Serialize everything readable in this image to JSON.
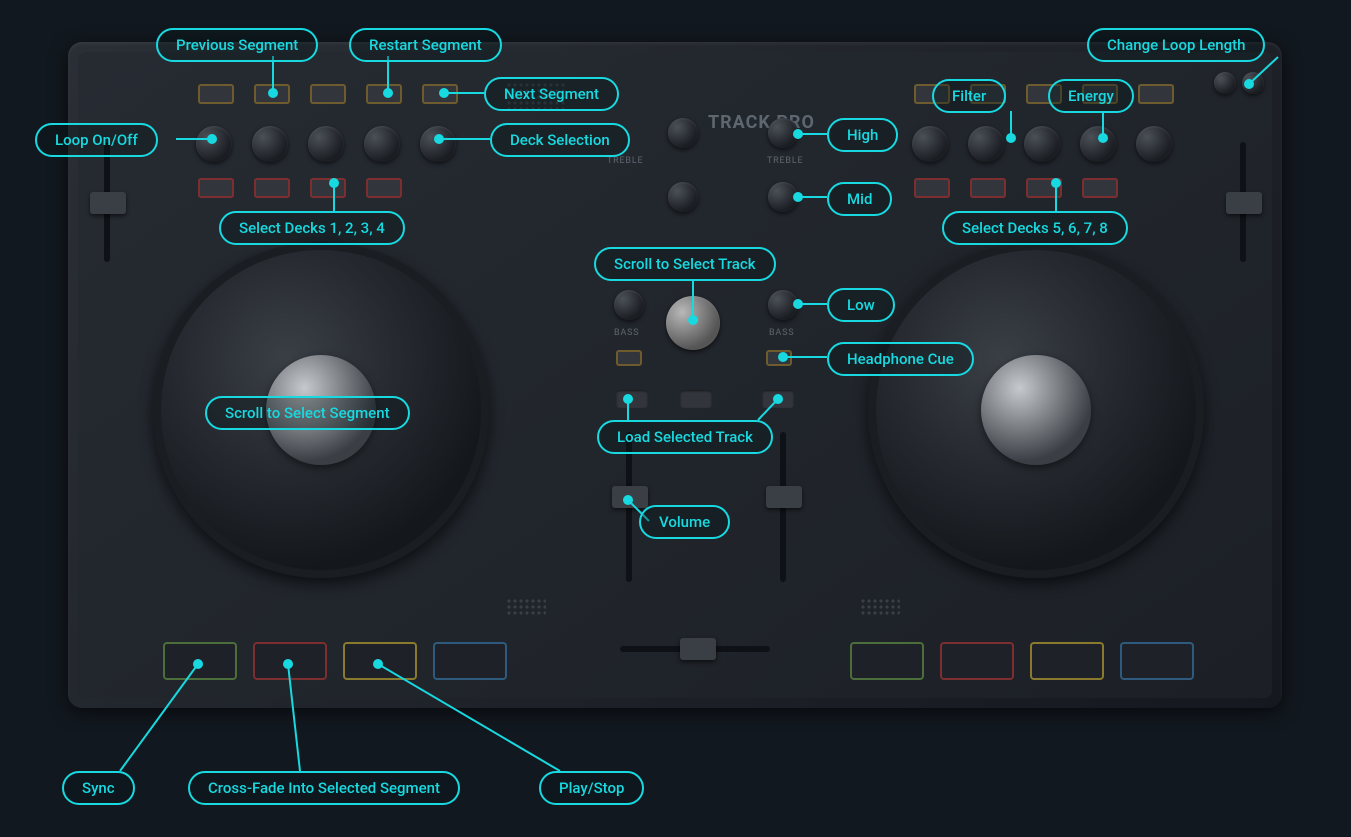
{
  "product": {
    "name": "TRACK PRO"
  },
  "eq": {
    "treble": "TREBLE",
    "bass": "BASS"
  },
  "labels": {
    "previous_segment": "Previous Segment",
    "restart_segment": "Restart Segment",
    "next_segment": "Next Segment",
    "change_loop_length": "Change Loop Length",
    "loop_on_off": "Loop On/Off",
    "deck_selection": "Deck Selection",
    "filter": "Filter",
    "energy": "Energy",
    "high": "High",
    "mid": "Mid",
    "low": "Low",
    "select_decks_left": "Select Decks 1, 2, 3, 4",
    "select_decks_right": "Select Decks 5, 6, 7, 8",
    "scroll_select_track": "Scroll to Select Track",
    "headphone_cue": "Headphone Cue",
    "scroll_select_segment": "Scroll to Select Segment",
    "load_selected_track": "Load Selected Track",
    "volume": "Volume",
    "sync": "Sync",
    "crossfade_segment": "Cross-Fade Into Selected Segment",
    "play_stop": "Play/Stop"
  }
}
